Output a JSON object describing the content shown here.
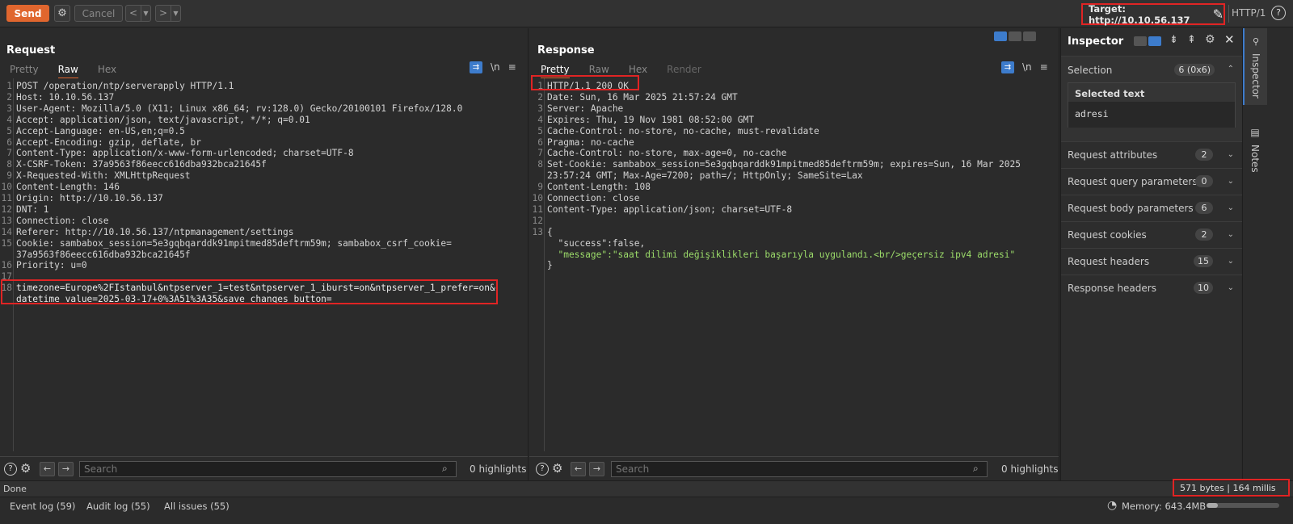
{
  "toolbar": {
    "send_label": "Send",
    "cancel_label": "Cancel",
    "target_label": "Target: http://10.10.56.137",
    "protocol": "HTTP/1"
  },
  "request": {
    "title": "Request",
    "tabs": [
      "Pretty",
      "Raw",
      "Hex"
    ],
    "active_tab": "Raw",
    "lines": [
      {
        "n": "1",
        "t": "POST /operation/ntp/serverapply HTTP/1.1"
      },
      {
        "n": "2",
        "t": "Host: 10.10.56.137"
      },
      {
        "n": "3",
        "t": "User-Agent: Mozilla/5.0 (X11; Linux x86_64; rv:128.0) Gecko/20100101 Firefox/128.0"
      },
      {
        "n": "4",
        "t": "Accept: application/json, text/javascript, */*; q=0.01"
      },
      {
        "n": "5",
        "t": "Accept-Language: en-US,en;q=0.5"
      },
      {
        "n": "6",
        "t": "Accept-Encoding: gzip, deflate, br"
      },
      {
        "n": "7",
        "t": "Content-Type: application/x-www-form-urlencoded; charset=UTF-8"
      },
      {
        "n": "8",
        "t": "X-CSRF-Token: 37a9563f86eecc616dba932bca21645f"
      },
      {
        "n": "9",
        "t": "X-Requested-With: XMLHttpRequest"
      },
      {
        "n": "10",
        "t": "Content-Length: 146"
      },
      {
        "n": "11",
        "t": "Origin: http://10.10.56.137"
      },
      {
        "n": "12",
        "t": "DNT: 1"
      },
      {
        "n": "13",
        "t": "Connection: close"
      },
      {
        "n": "14",
        "t": "Referer: http://10.10.56.137/ntpmanagement/settings"
      },
      {
        "n": "15",
        "t": "Cookie: sambabox_session=5e3gqbqarddk91mpitmed85deftrm59m; sambabox_csrf_cookie="
      },
      {
        "n": "",
        "t": "37a9563f86eecc616dba932bca21645f"
      },
      {
        "n": "16",
        "t": "Priority: u=0"
      },
      {
        "n": "17",
        "t": ""
      },
      {
        "n": "18",
        "t": "timezone=Europe%2FIstanbul&ntpserver_1=test&ntpserver_1_iburst=on&ntpserver_1_prefer=on&"
      },
      {
        "n": "",
        "t": "datetime_value=2025-03-17+0%3A51%3A35&save_changes_button="
      }
    ],
    "search_placeholder": "Search",
    "highlights": "0 highlights"
  },
  "response": {
    "title": "Response",
    "tabs": [
      "Pretty",
      "Raw",
      "Hex",
      "Render"
    ],
    "active_tab": "Pretty",
    "lines": [
      {
        "n": "1",
        "t": "HTTP/1.1 200 OK"
      },
      {
        "n": "2",
        "t": "Date: Sun, 16 Mar 2025 21:57:24 GMT"
      },
      {
        "n": "3",
        "t": "Server: Apache"
      },
      {
        "n": "4",
        "t": "Expires: Thu, 19 Nov 1981 08:52:00 GMT"
      },
      {
        "n": "5",
        "t": "Cache-Control: no-store, no-cache, must-revalidate"
      },
      {
        "n": "6",
        "t": "Pragma: no-cache"
      },
      {
        "n": "7",
        "t": "Cache-Control: no-store, max-age=0, no-cache"
      },
      {
        "n": "8",
        "t": "Set-Cookie: sambabox_session=5e3gqbqarddk91mpitmed85deftrm59m; expires=Sun, 16 Mar 2025"
      },
      {
        "n": "",
        "t": "23:57:24 GMT; Max-Age=7200; path=/; HttpOnly; SameSite=Lax"
      },
      {
        "n": "9",
        "t": "Content-Length: 108"
      },
      {
        "n": "10",
        "t": "Connection: close"
      },
      {
        "n": "11",
        "t": "Content-Type: application/json; charset=UTF-8"
      },
      {
        "n": "12",
        "t": ""
      },
      {
        "n": "13",
        "t": "{"
      },
      {
        "n": "",
        "t": "  \"success\":false,"
      },
      {
        "n": "",
        "t": "  \"message\":\"saat dilimi değişiklikleri başarıyla uygulandı.<br/>geçersiz ipv4 adresi\""
      },
      {
        "n": "",
        "t": "}"
      }
    ],
    "selected_word": "adresi",
    "search_placeholder": "Search",
    "highlights": "0 highlights"
  },
  "inspector": {
    "title": "Inspector",
    "selection_label": "Selection",
    "selection_badge": "6 (0x6)",
    "selected_text_label": "Selected text",
    "selected_text_value": "adresi",
    "sections": [
      {
        "label": "Request attributes",
        "count": "2"
      },
      {
        "label": "Request query parameters",
        "count": "0"
      },
      {
        "label": "Request body parameters",
        "count": "6"
      },
      {
        "label": "Request cookies",
        "count": "2"
      },
      {
        "label": "Request headers",
        "count": "15"
      },
      {
        "label": "Response headers",
        "count": "10"
      }
    ]
  },
  "sidetabs": {
    "inspector": "Inspector",
    "notes": "Notes"
  },
  "status": {
    "left": "Done",
    "right": "571 bytes | 164 millis"
  },
  "footer": {
    "event_log": "Event log (59)",
    "audit_log": "Audit log (55)",
    "all_issues": "All issues (55)",
    "memory": "Memory: 643.4MB"
  }
}
